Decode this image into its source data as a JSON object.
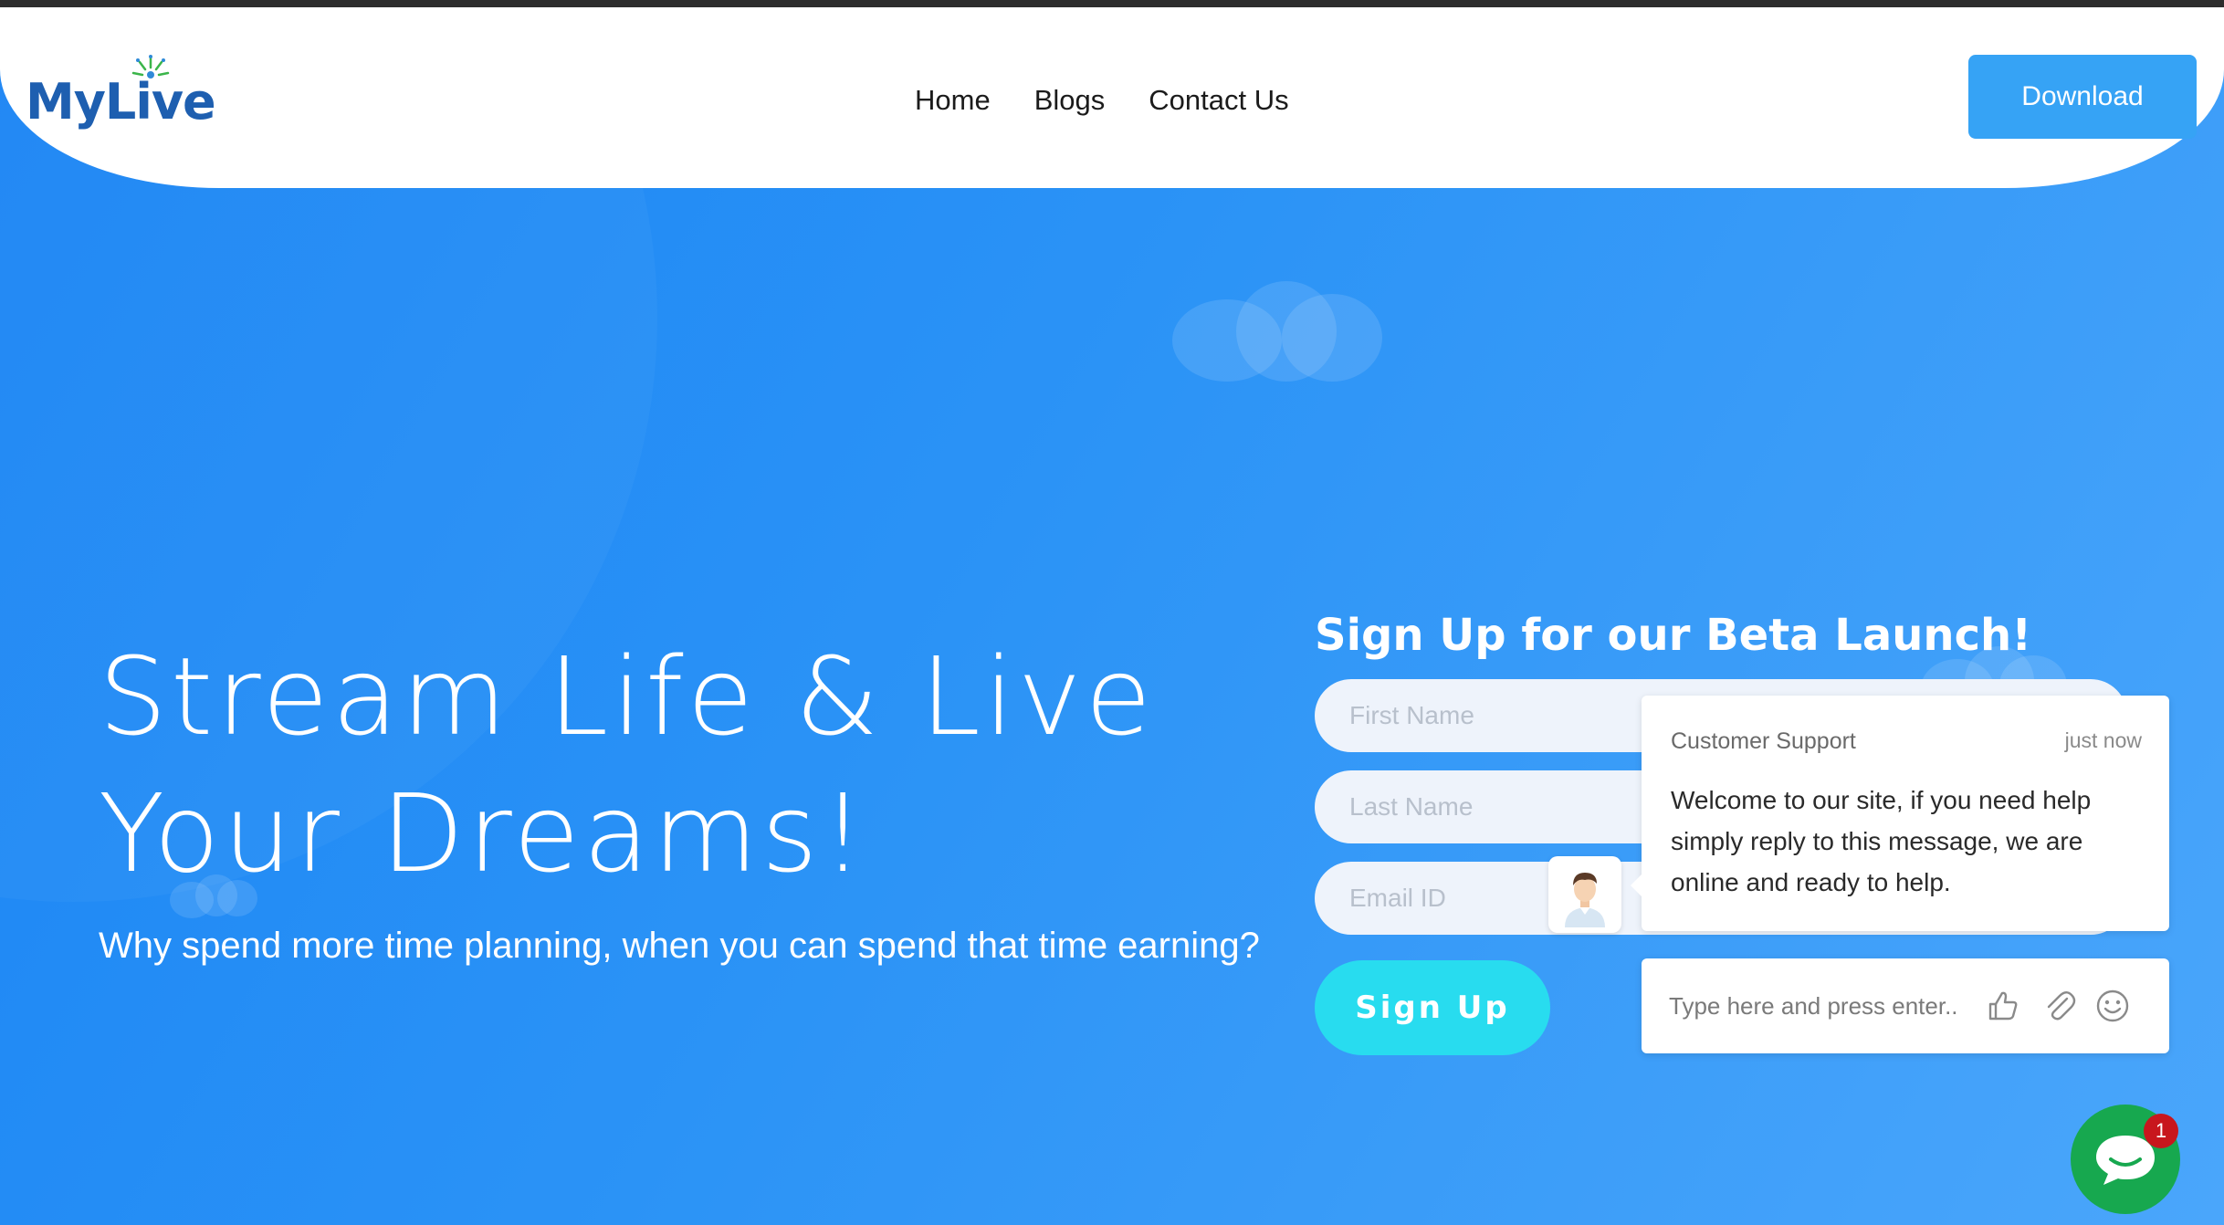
{
  "brand": {
    "logo_text": "MyLive"
  },
  "nav": {
    "items": [
      "Home",
      "Blogs",
      "Contact Us"
    ]
  },
  "header": {
    "download_label": "Download"
  },
  "hero": {
    "title_line1": "Stream Life & Live",
    "title_line2": "Your Dreams!",
    "subtitle": "Why spend more time planning, when you can spend that time earning?"
  },
  "signup": {
    "title": "Sign Up for our Beta Launch!",
    "first_name_placeholder": "First Name",
    "last_name_placeholder": "Last Name",
    "email_placeholder": "Email ID",
    "button_label": "Sign Up"
  },
  "chat": {
    "from": "Customer Support",
    "time": "just now",
    "message": "Welcome to our site, if you need help simply reply to this message, we are online and ready to help.",
    "input_placeholder": "Type here and press enter..",
    "badge_count": "1",
    "icons": [
      "thumbs-up-icon",
      "paperclip-icon",
      "emoji-icon"
    ]
  },
  "colors": {
    "background_start": "#1a84f4",
    "background_end": "#4aa6fb",
    "download_button": "#36a3f5",
    "signup_button": "#28dcef",
    "chat_launcher": "#17a84f",
    "badge": "#c8161d",
    "logo": "#1e5fb0"
  }
}
